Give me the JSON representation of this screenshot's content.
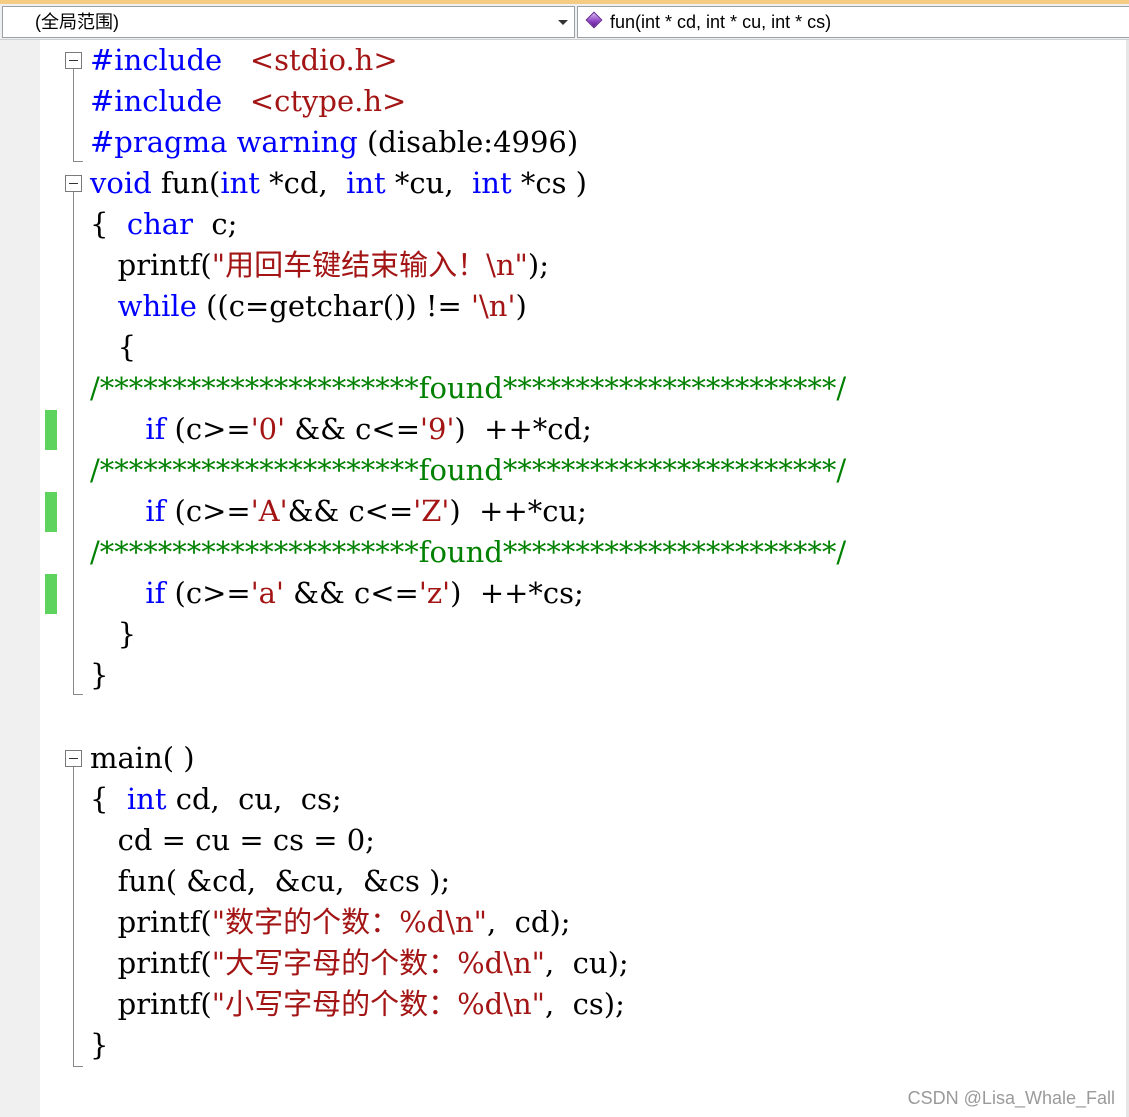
{
  "navbar": {
    "scope_label": "(全局范围)",
    "member_label": "fun(int * cd, int * cu, int * cs)"
  },
  "code": {
    "l1": [
      "#include",
      "   <stdio.h>"
    ],
    "l2": [
      "#include",
      "   <ctype.h>"
    ],
    "l3": [
      "#pragma warning",
      " (disable:4996)"
    ],
    "l4": [
      "void",
      " fun(",
      "int",
      " *cd,  ",
      "int",
      " *cu,  ",
      "int",
      " *cs )"
    ],
    "l5": [
      "{  ",
      "char",
      "  c;"
    ],
    "l6": [
      "   printf(",
      "\"用回车键结束输入！\\n\"",
      ");"
    ],
    "l7": [
      "   ",
      "while",
      " ((c=getchar()) != ",
      "'\\n'",
      ")"
    ],
    "l8": "   {",
    "l9": "/**********************found***********************/",
    "l10": [
      "      ",
      "if",
      " (c>=",
      "'0'",
      " && c<=",
      "'9'",
      ")  ++*cd;"
    ],
    "l11": "/**********************found***********************/",
    "l12": [
      "      ",
      "if",
      " (c>=",
      "'A'",
      "&& c<=",
      "'Z'",
      ")  ++*cu;"
    ],
    "l13": "/**********************found***********************/",
    "l14": [
      "      ",
      "if",
      " (c>=",
      "'a'",
      " && c<=",
      "'z'",
      ")  ++*cs;"
    ],
    "l15": "   }",
    "l16": "}",
    "l17": "main( )",
    "l18": [
      "{  ",
      "int",
      " cd,  cu,  cs;"
    ],
    "l19": "   cd = cu = cs = 0;",
    "l20": "   fun( &cd,  &cu,  &cs );",
    "l21": [
      "   printf(",
      "\"数字的个数：%d\\n\"",
      ",  cd);"
    ],
    "l22": [
      "   printf(",
      "\"大写字母的个数：%d\\n\"",
      ",  cu);"
    ],
    "l23": [
      "   printf(",
      "\"小写字母的个数：%d\\n\"",
      ",  cs);"
    ],
    "l24": "}"
  },
  "watermark": "CSDN @Lisa_Whale_Fall",
  "colors": {
    "keyword": "#0000ff",
    "string": "#a31515",
    "comment": "#008000",
    "change_marker": "#5ed35e"
  },
  "icons": {
    "scope_dropdown": "chevron-down-icon",
    "member_icon": "method-icon",
    "fold": "collapse-icon"
  }
}
